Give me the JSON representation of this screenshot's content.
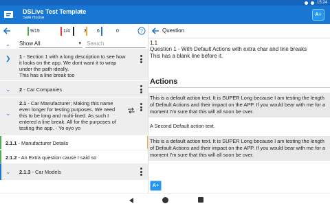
{
  "statusbar": {
    "time": "15:24"
  },
  "appbar": {
    "title": "DSLive Test Template",
    "subtitle": "Safe House",
    "add_label": "A+"
  },
  "counters": [
    {
      "value": "9/15",
      "color": "#4caf50"
    },
    {
      "value": "1/4",
      "color": "#e53935"
    },
    {
      "value": "3",
      "color": "#212121"
    },
    {
      "value": "6",
      "color": "#f9a825"
    },
    {
      "value": "0",
      "color": "#1976d2"
    }
  ],
  "filter": {
    "selected": "Show All",
    "search_placeholder": "Search"
  },
  "list": {
    "items": [
      {
        "num": "1",
        "text": "Section 1 with a long description to see how it looks on the app. We dont want it to wrap under the path ideally.",
        "text2": "This has a line break too"
      },
      {
        "num": "2",
        "text": "Car Companies"
      },
      {
        "num": "2.1",
        "text": "Car Manufacturer; Making this name even longer for testing purposes. We need this to be long and multi-lined. As such I entered a line break. All for the purposes of testing the app. - Yo oyo yo"
      },
      {
        "num": "2.1.1",
        "text": "Manufacturer Details"
      },
      {
        "num": "2.1.2",
        "text": "An Extra question cause I said so"
      },
      {
        "num": "2.1.3",
        "text": "Car Models"
      }
    ]
  },
  "question": {
    "header": "Question",
    "number": "1.1",
    "text": "Question 1 - With Default Actions with extra char and line breaks",
    "text2": "This has a blank line before it.",
    "actions_title": "Actions",
    "actions": [
      "This is a default action text. It is SUPER Long because I am testing the length of Default Actions and their impact on the APP. If you would bear with me for a moment I'm sure that this will all soon be over.",
      "A Second Default action text.",
      "This is a default action text. It is SUPER Long because I am testing the length of Default Actions and their impact on the APP. If you would bear with me for a moment I'm sure that this will all soon be over."
    ],
    "add_label": "A+"
  }
}
